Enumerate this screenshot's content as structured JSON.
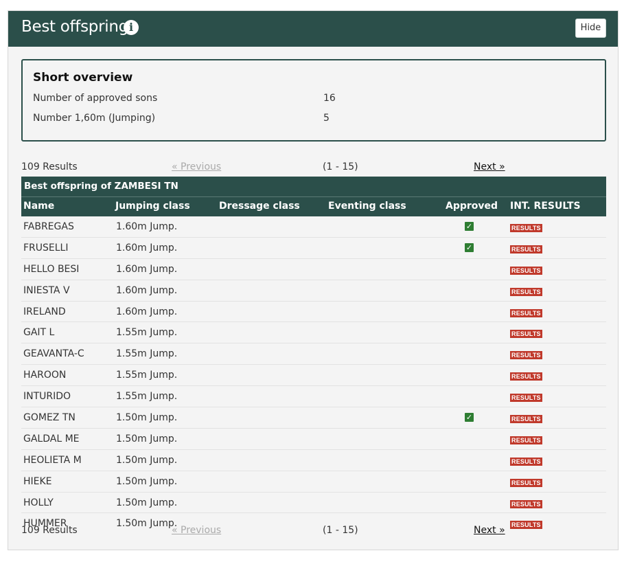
{
  "header": {
    "title": "Best offspring",
    "info_icon": "info-icon",
    "hide_label": "Hide"
  },
  "overview": {
    "title": "Short overview",
    "rows": [
      {
        "label": "Number of approved sons",
        "value": "16"
      },
      {
        "label": "Number 1,60m (Jumping)",
        "value": "5"
      }
    ]
  },
  "pager": {
    "count": "109 Results",
    "previous": "« Previous",
    "range": "(1 - 15)",
    "next": "Next »"
  },
  "table": {
    "caption": "Best offspring of ZAMBESI TN",
    "columns": [
      "Name",
      "Jumping class",
      "Dressage class",
      "Eventing class",
      "Approved",
      "INT. RESULTS"
    ],
    "results_label": "RESULTS",
    "check_mark": "✓",
    "rows": [
      {
        "name": "FABREGAS",
        "jumping": "1.60m Jump.",
        "approved": true
      },
      {
        "name": "FRUSELLI",
        "jumping": "1.60m Jump.",
        "approved": true
      },
      {
        "name": "HELLO BESI",
        "jumping": "1.60m Jump.",
        "approved": false
      },
      {
        "name": "INIESTA V",
        "jumping": "1.60m Jump.",
        "approved": false
      },
      {
        "name": "IRELAND",
        "jumping": "1.60m Jump.",
        "approved": false
      },
      {
        "name": "GAIT L",
        "jumping": "1.55m Jump.",
        "approved": false
      },
      {
        "name": "GEAVANTA-C",
        "jumping": "1.55m Jump.",
        "approved": false
      },
      {
        "name": "HAROON",
        "jumping": "1.55m Jump.",
        "approved": false
      },
      {
        "name": "INTURIDO",
        "jumping": "1.55m Jump.",
        "approved": false
      },
      {
        "name": "GOMEZ TN",
        "jumping": "1.50m Jump.",
        "approved": true
      },
      {
        "name": "GALDAL ME",
        "jumping": "1.50m Jump.",
        "approved": false
      },
      {
        "name": "HEOLIETA M",
        "jumping": "1.50m Jump.",
        "approved": false
      },
      {
        "name": "HIEKE",
        "jumping": "1.50m Jump.",
        "approved": false
      },
      {
        "name": "HOLLY",
        "jumping": "1.50m Jump.",
        "approved": false
      },
      {
        "name": "HUMMER",
        "jumping": "1.50m Jump.",
        "approved": false
      }
    ]
  },
  "colors": {
    "header_bg": "#2b4f4a",
    "approved_check": "#2e7d32",
    "results_badge": "#c0392b"
  }
}
